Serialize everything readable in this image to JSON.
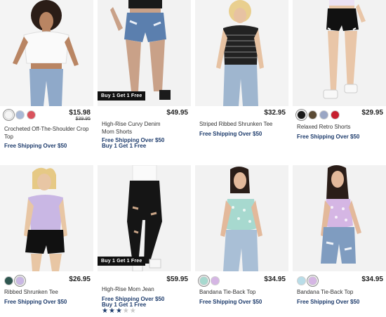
{
  "products": [
    {
      "name": "Crocheted Off-The-Shoulder Crop Top",
      "price": "$15.98",
      "original_price": "$39.95",
      "swatches": [
        "#f5f5f5",
        "#a9b9d6",
        "#d9535d"
      ],
      "promos": [
        "Free Shipping Over $50"
      ],
      "badge": ""
    },
    {
      "name": "High-Rise Curvy Denim Mom Shorts",
      "price": "$49.95",
      "swatches": [],
      "promos": [
        "Free Shipping Over $50",
        "Buy 1 Get 1 Free"
      ],
      "badge": "Buy 1 Get 1 Free"
    },
    {
      "name": "Striped Ribbed Shrunken Tee",
      "price": "$32.95",
      "swatches": [],
      "promos": [
        "Free Shipping Over $50"
      ],
      "badge": ""
    },
    {
      "name": "Relaxed Retro Shorts",
      "price": "$29.95",
      "swatches": [
        "#1a1a1a",
        "#5a4a34",
        "#9aa6c4",
        "#c61f2e"
      ],
      "promos": [
        "Free Shipping Over $50"
      ],
      "badge": ""
    },
    {
      "name": "Ribbed Shrunken Tee",
      "price": "$26.95",
      "swatches": [
        "#2f5750",
        "#c9b7e4"
      ],
      "promos": [
        "Free Shipping Over $50"
      ],
      "badge": ""
    },
    {
      "name": "High-Rise Mom Jean",
      "price": "$59.95",
      "swatches": [],
      "promos": [
        "Free Shipping Over $50",
        "Buy 1 Get 1 Free"
      ],
      "badge": "Buy 1 Get 1 Free",
      "rating": 3,
      "rating_max": 5
    },
    {
      "name": "Bandana Tie-Back Top",
      "price": "$34.95",
      "swatches": [
        "#a7d9cf",
        "#d5b6e4"
      ],
      "promos": [
        "Free Shipping Over $50"
      ],
      "badge": ""
    },
    {
      "name": "Bandana Tie-Back Top",
      "price": "$34.95",
      "swatches": [
        "#b9dde8",
        "#d5b6e4"
      ],
      "promos": [
        "Free Shipping Over $50"
      ],
      "badge": ""
    }
  ]
}
